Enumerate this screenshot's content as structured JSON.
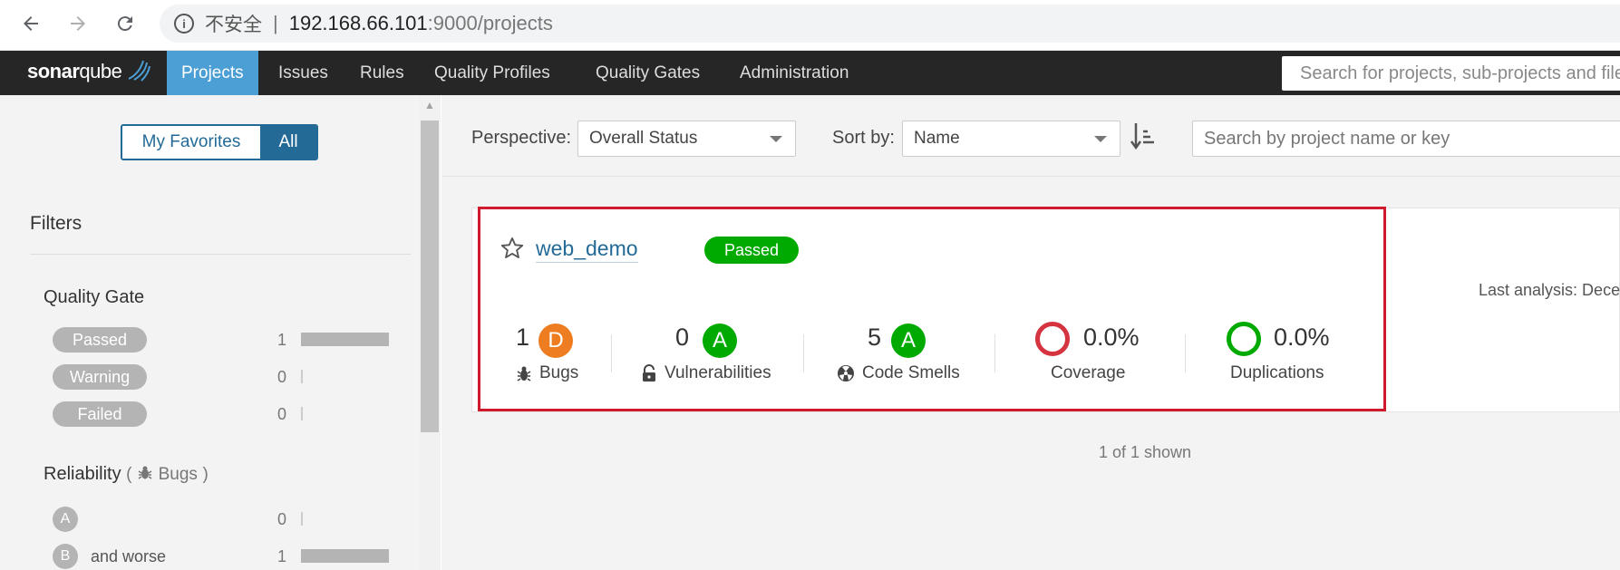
{
  "browser": {
    "insecure_label": "不安全",
    "url_host": "192.168.66.101",
    "url_path": ":9000/projects"
  },
  "nav": {
    "logo_bold": "sonar",
    "logo_light": "qube",
    "items": [
      "Projects",
      "Issues",
      "Rules",
      "Quality Profiles",
      "Quality Gates",
      "Administration"
    ],
    "active": "Projects",
    "search_placeholder": "Search for projects, sub-projects and files..."
  },
  "sidebar": {
    "toggle": {
      "favorites": "My Favorites",
      "all": "All"
    },
    "filters_title": "Filters",
    "quality_gate": {
      "title": "Quality Gate",
      "items": [
        {
          "label": "Passed",
          "count": "1"
        },
        {
          "label": "Warning",
          "count": "0"
        },
        {
          "label": "Failed",
          "count": "0"
        }
      ]
    },
    "reliability": {
      "title": "Reliability",
      "paren_open": "(",
      "sub": "Bugs",
      "paren_close": ")",
      "items": [
        {
          "rating": "A",
          "extra": "",
          "count": "0"
        },
        {
          "rating": "B",
          "extra": "and worse",
          "count": "1"
        }
      ]
    }
  },
  "toolbar": {
    "perspective_label": "Perspective:",
    "perspective_value": "Overall Status",
    "sort_label": "Sort by:",
    "sort_value": "Name",
    "search_placeholder": "Search by project name or key"
  },
  "project": {
    "name": "web_demo",
    "status": "Passed",
    "last_analysis": "Last analysis: December",
    "bugs": {
      "value": "1",
      "rating": "D",
      "label": "Bugs"
    },
    "vulnerabilities": {
      "value": "0",
      "rating": "A",
      "label": "Vulnerabilities"
    },
    "code_smells": {
      "value": "5",
      "rating": "A",
      "label": "Code Smells"
    },
    "coverage": {
      "value": "0.0%",
      "label": "Coverage"
    },
    "duplications": {
      "value": "0.0%",
      "label": "Duplications"
    }
  },
  "footer": {
    "shown": "1 of 1 shown"
  },
  "colors": {
    "nav_bg": "#262626",
    "nav_active": "#4b9fd5",
    "link": "#236a97",
    "passed": "#00aa00",
    "rating_d": "#ed7d20",
    "highlight": "#d0192b"
  }
}
